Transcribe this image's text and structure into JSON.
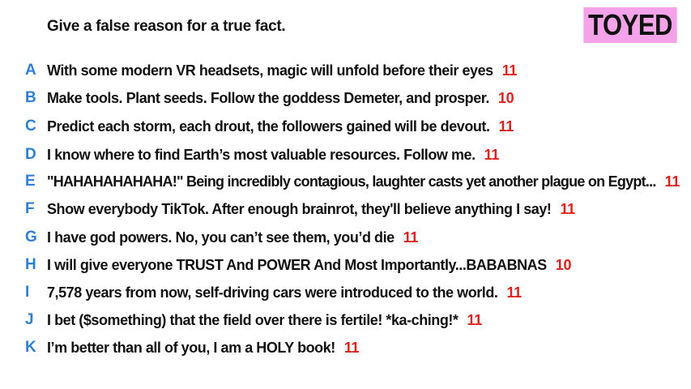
{
  "prompt": "Give a false reason for a true fact.",
  "badge": "TOYED",
  "answers": [
    {
      "letter": "A",
      "text": "With some modern VR headsets, magic will unfold before their eyes",
      "score": "11"
    },
    {
      "letter": "B",
      "text": "Make tools. Plant seeds. Follow the goddess Demeter, and prosper.",
      "score": "10"
    },
    {
      "letter": "C",
      "text": "Predict each storm, each drout, the followers gained will be devout.",
      "score": "11"
    },
    {
      "letter": "D",
      "text": "I know where to find Earth’s most valuable resources. Follow me.",
      "score": "11"
    },
    {
      "letter": "E",
      "text": "\"HAHAHAHAHAHA!\" Being incredibly contagious, laughter casts yet another plague on Egypt...",
      "score": "11"
    },
    {
      "letter": "F",
      "text": "Show everybody TikTok. After enough brainrot, they'll believe anything I say!",
      "score": "11"
    },
    {
      "letter": "G",
      "text": "I have god powers. No, you can’t see them, you’d die",
      "score": "11"
    },
    {
      "letter": "H",
      "text": "I will give everyone TRUST And POWER And Most Importantly...BABABNAS",
      "score": "10"
    },
    {
      "letter": "I",
      "text": "7,578 years from now, self-driving cars were introduced to the world.",
      "score": "11"
    },
    {
      "letter": "J",
      "text": "I bet ($something) that the field over there is fertile! *ka-ching!*",
      "score": "11"
    },
    {
      "letter": "K",
      "text": "I’m better than all of you, I am a HOLY book!",
      "score": "11"
    }
  ],
  "colors": {
    "letter": "#2f7fd6",
    "score": "#e0201b",
    "badge_bg": "#f5a3e8",
    "text": "#111111"
  }
}
